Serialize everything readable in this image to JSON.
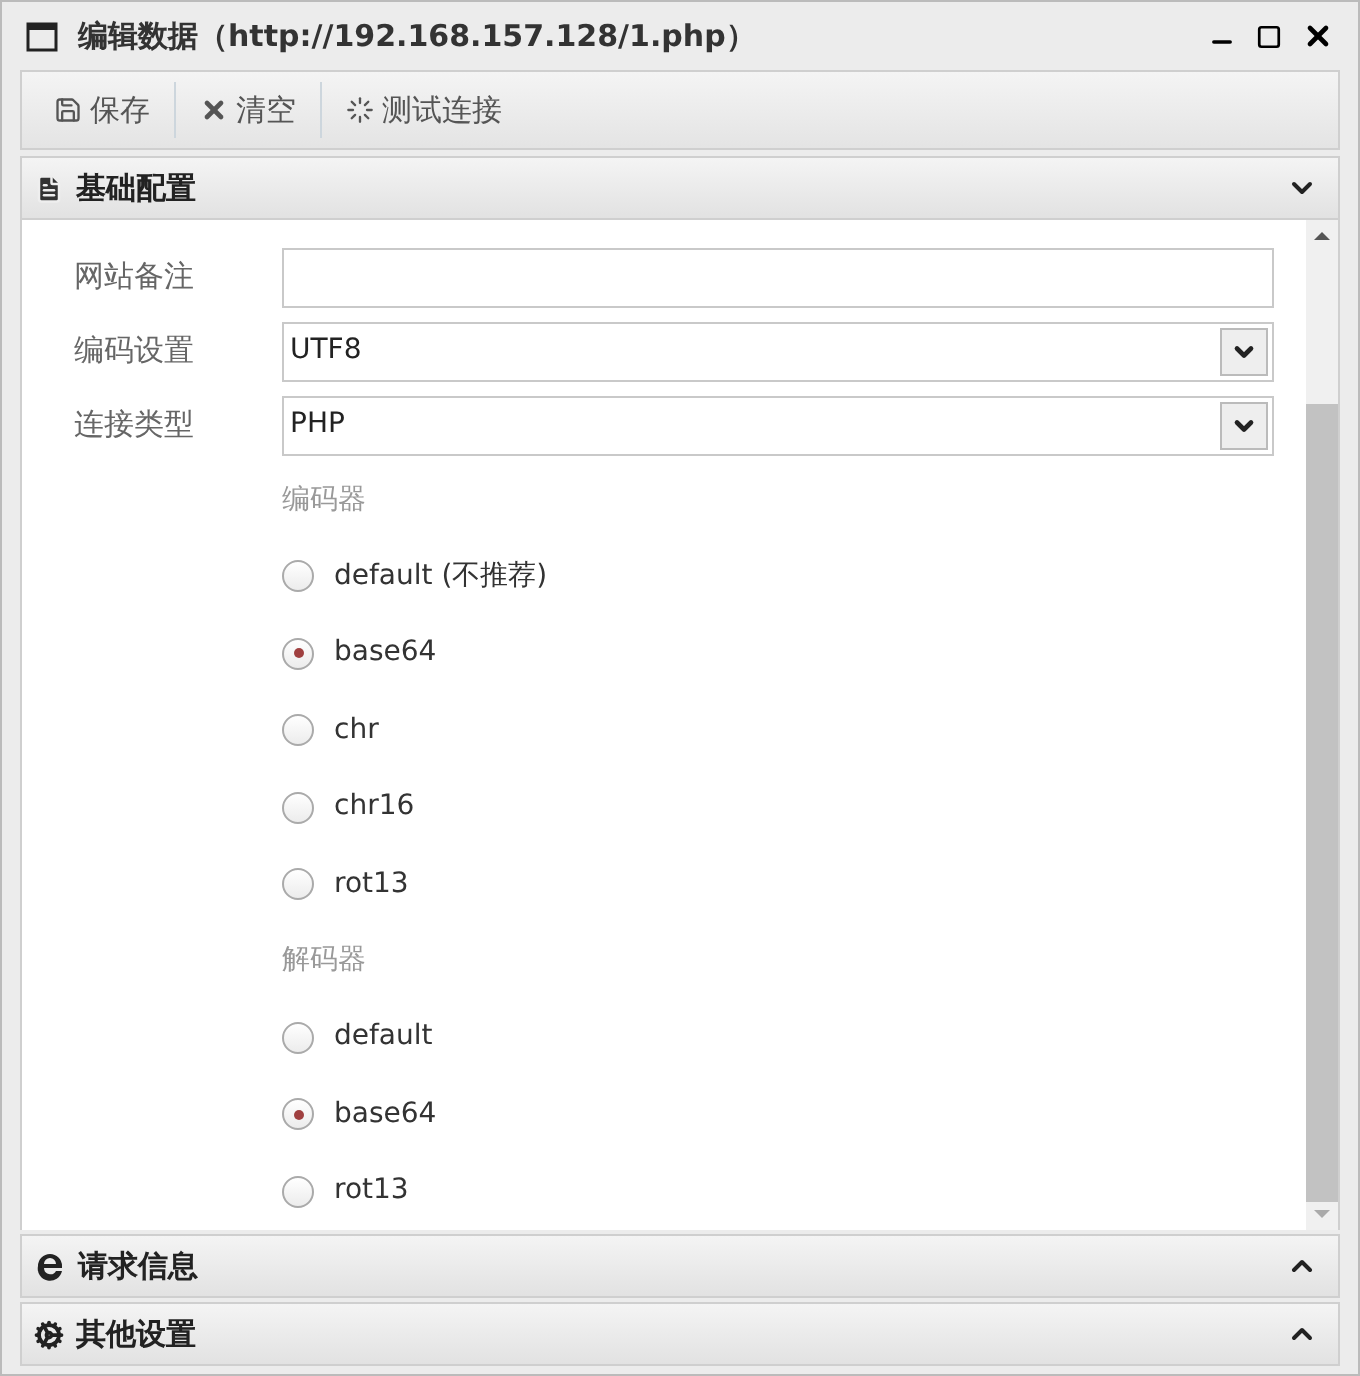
{
  "window": {
    "title": "编辑数据（http://192.168.157.128/1.php）"
  },
  "toolbar": [
    {
      "kind": "save",
      "label": "保存"
    },
    {
      "kind": "clear",
      "label": "清空"
    },
    {
      "kind": "test",
      "label": "测试连接"
    }
  ],
  "sections": [
    {
      "kind": "file",
      "title": "基础配置",
      "expanded": true
    },
    {
      "kind": "web",
      "title": "请求信息",
      "expanded": false
    },
    {
      "kind": "gears",
      "title": "其他设置",
      "expanded": false
    }
  ],
  "fields": [
    {
      "kind": "text",
      "label": "网站备注"
    },
    {
      "kind": "select",
      "label": "编码设置",
      "value": "UTF8"
    },
    {
      "kind": "select",
      "label": "连接类型",
      "value": "PHP"
    }
  ],
  "radio_groups": [
    {
      "title": "编码器",
      "options": [
        {
          "label": "default (不推荐)",
          "selected": false
        },
        {
          "label": "base64",
          "selected": true
        },
        {
          "label": "chr",
          "selected": false
        },
        {
          "label": "chr16",
          "selected": false
        },
        {
          "label": "rot13",
          "selected": false
        }
      ]
    },
    {
      "title": "解码器",
      "options": [
        {
          "label": "default",
          "selected": false
        },
        {
          "label": "base64",
          "selected": true
        },
        {
          "label": "rot13",
          "selected": false
        }
      ]
    }
  ]
}
